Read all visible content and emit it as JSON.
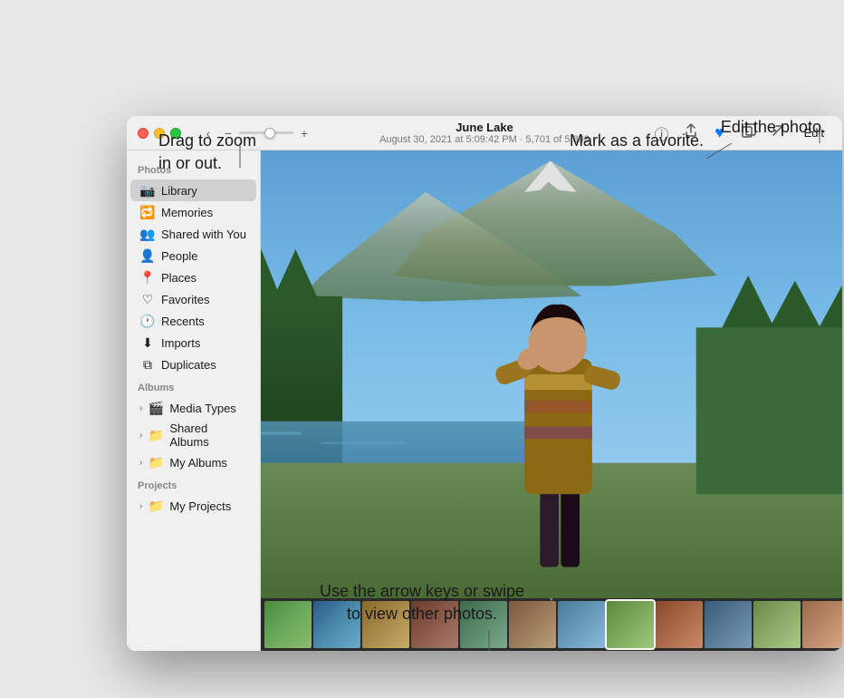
{
  "annotations": {
    "drag_zoom": "Drag to zoom\nin or out.",
    "mark_favorite": "Mark as a favorite.",
    "edit_photo": "Edit the photo.",
    "arrow_keys": "Use the arrow keys or swipe\nto view other photos."
  },
  "window": {
    "title": "June Lake",
    "subtitle": "August 30, 2021 at 5:09:42 PM  ·  5,701 of 5,893",
    "edit_label": "Edit"
  },
  "sidebar": {
    "photos_section": "Photos",
    "albums_section": "Albums",
    "projects_section": "Projects",
    "items": [
      {
        "label": "Library",
        "icon": "📷",
        "active": true
      },
      {
        "label": "Memories",
        "icon": "🔁",
        "active": false
      },
      {
        "label": "Shared with You",
        "icon": "👥",
        "active": false
      },
      {
        "label": "People",
        "icon": "👤",
        "active": false
      },
      {
        "label": "Places",
        "icon": "📍",
        "active": false
      },
      {
        "label": "Favorites",
        "icon": "♡",
        "active": false
      },
      {
        "label": "Recents",
        "icon": "🕐",
        "active": false
      },
      {
        "label": "Imports",
        "icon": "⬇",
        "active": false
      },
      {
        "label": "Duplicates",
        "icon": "⧉",
        "active": false
      }
    ],
    "album_groups": [
      {
        "label": "Media Types"
      },
      {
        "label": "Shared Albums"
      },
      {
        "label": "My Albums"
      }
    ],
    "project_groups": [
      {
        "label": "My Projects"
      }
    ]
  },
  "toolbar": {
    "info_icon": "ⓘ",
    "share_icon": "⬆",
    "favorite_icon": "♥",
    "copy_icon": "⬜",
    "enhance_icon": "✦",
    "edit_label": "Edit"
  },
  "filmstrip": {
    "thumbs": 15,
    "active_index": 7
  }
}
